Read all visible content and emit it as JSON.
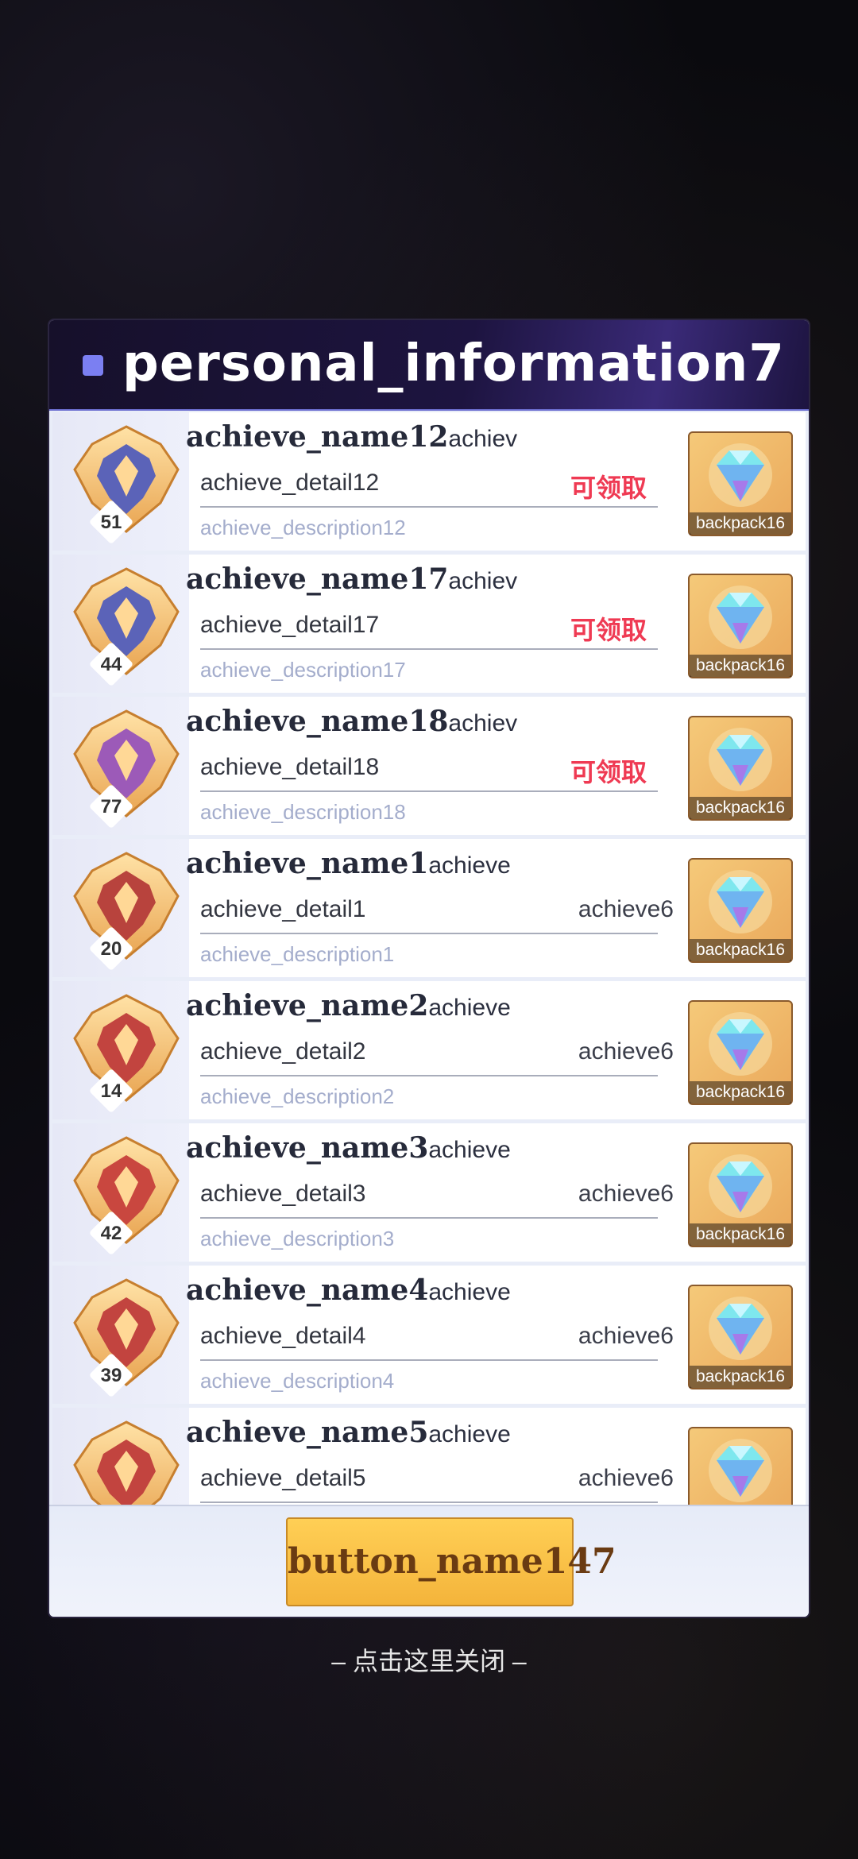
{
  "panel": {
    "title": "personal_information7"
  },
  "achievements": [
    {
      "name": "achieve_name12",
      "name_extra": "achiev",
      "level": "51",
      "detail": "achieve_detail12",
      "status": "可领取",
      "status_claimable": true,
      "description": "achieve_description12",
      "reward_label": "backpack16",
      "badge_color": "#5b63b8"
    },
    {
      "name": "achieve_name17",
      "name_extra": "achiev",
      "level": "44",
      "detail": "achieve_detail17",
      "status": "可领取",
      "status_claimable": true,
      "description": "achieve_description17",
      "reward_label": "backpack16",
      "badge_color": "#5b63b8"
    },
    {
      "name": "achieve_name18",
      "name_extra": "achiev",
      "level": "77",
      "detail": "achieve_detail18",
      "status": "可领取",
      "status_claimable": true,
      "description": "achieve_description18",
      "reward_label": "backpack16",
      "badge_color": "#9c5ab8"
    },
    {
      "name": "achieve_name1",
      "name_extra": "achieve",
      "level": "20",
      "detail": "achieve_detail1",
      "status": "achieve6",
      "status_claimable": false,
      "description": "achieve_description1",
      "reward_label": "backpack16",
      "badge_color": "#b8433d"
    },
    {
      "name": "achieve_name2",
      "name_extra": "achieve",
      "level": "14",
      "detail": "achieve_detail2",
      "status": "achieve6",
      "status_claimable": false,
      "description": "achieve_description2",
      "reward_label": "backpack16",
      "badge_color": "#c2443f"
    },
    {
      "name": "achieve_name3",
      "name_extra": "achieve",
      "level": "42",
      "detail": "achieve_detail3",
      "status": "achieve6",
      "status_claimable": false,
      "description": "achieve_description3",
      "reward_label": "backpack16",
      "badge_color": "#c9473f"
    },
    {
      "name": "achieve_name4",
      "name_extra": "achieve",
      "level": "39",
      "detail": "achieve_detail4",
      "status": "achieve6",
      "status_claimable": false,
      "description": "achieve_description4",
      "reward_label": "backpack16",
      "badge_color": "#c2443f"
    },
    {
      "name": "achieve_name5",
      "name_extra": "achieve",
      "level": "",
      "detail": "achieve_detail5",
      "status": "achieve6",
      "status_claimable": false,
      "description": "",
      "reward_label": "",
      "badge_color": "#c2443f"
    }
  ],
  "footer": {
    "button_label": "button_name147"
  },
  "close_hint": "– 点击这里关闭 –"
}
